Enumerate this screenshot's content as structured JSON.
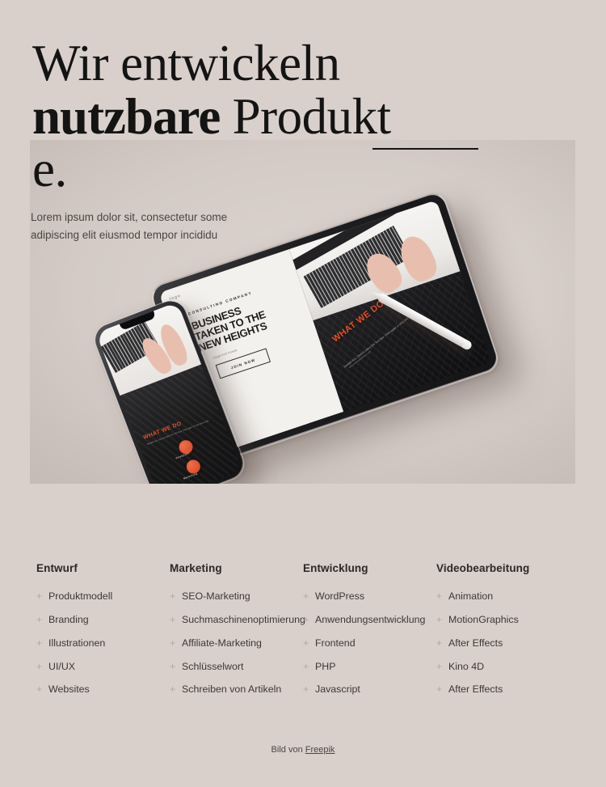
{
  "theme": {
    "background": "#d9d0cb",
    "heading_color": "#141414",
    "text_color": "#3b3634",
    "accent_orange": "#e8512b",
    "plus_color": "#b3a8a3"
  },
  "hero": {
    "heading_line1": "Wir entwickeln",
    "heading_strong": "nutzbare",
    "heading_rest": "Produkt",
    "heading_line3": "e.",
    "subtitle": "Lorem ipsum dolor sit, consectetur some adipiscing elit eiusmod tempor incididu"
  },
  "mockup": {
    "tablet": {
      "logo": "logo",
      "eyebrow": "CONSULTING COMPANY",
      "headline_line1": "BUSINESS",
      "headline_line2": "TAKEN TO THE",
      "headline_line3": "NEW HEIGHTS",
      "note": "Image from Freepik",
      "button": "JOIN NOW",
      "panel_title": "WHAT WE DO",
      "panel_text": "Sample text. Click to select the Text Box. Click again or click text to edit.",
      "panel_url": "www.yourwebsitehere.com"
    },
    "phone": {
      "panel_title": "WHAT WE DO",
      "panel_text": "Sample text. Click to select the Text Box. Click again or click text to edit.",
      "badge_label_1": "Analytics",
      "badge_label_2": "Marketing"
    }
  },
  "services": [
    {
      "title": "Entwurf",
      "items": [
        "Produktmodell",
        "Branding",
        "Illustrationen",
        "UI/UX",
        "Websites"
      ]
    },
    {
      "title": "Marketing",
      "items": [
        "SEO-Marketing",
        "Suchmaschinenoptimierung",
        "Affiliate-Marketing",
        "Schlüsselwort",
        "Schreiben von Artikeln"
      ]
    },
    {
      "title": "Entwicklung",
      "items": [
        "WordPress",
        "Anwendungsentwicklung",
        "Frontend",
        "PHP",
        "Javascript"
      ]
    },
    {
      "title": "Videobearbeitung",
      "items": [
        "Animation",
        "MotionGraphics",
        "After Effects",
        "Kino 4D",
        "After Effects"
      ]
    }
  ],
  "footer": {
    "credit_prefix": "Bild von ",
    "credit_link": "Freepik"
  }
}
